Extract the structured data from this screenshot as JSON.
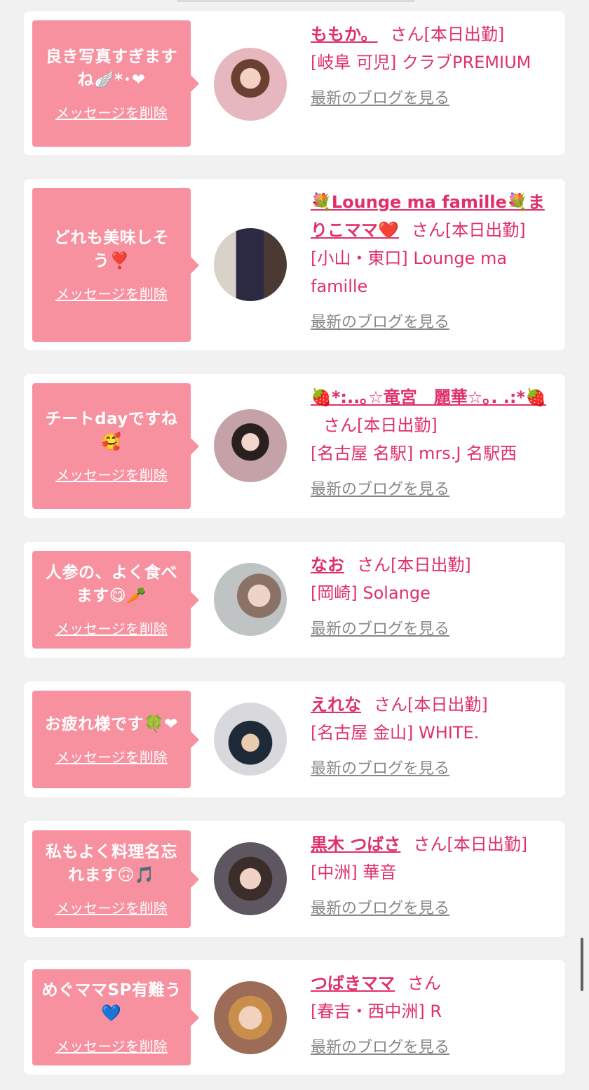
{
  "cards": [
    {
      "message": "良き写真すぎますね🪽*･❤︎",
      "delete_label": "メッセージを削除",
      "name": "ももか。",
      "san": "さん",
      "status": "[本日出勤]",
      "shop": "[岐阜 可児] クラブPREMIUM",
      "blog_label": "最新のブログを見る"
    },
    {
      "message": "どれも美味しそう❣️",
      "delete_label": "メッセージを削除",
      "name": "💐Lounge ma famille💐まりこママ❤️",
      "san": "さん",
      "status": "[本日出勤]",
      "shop": "[小山・東口] Lounge ma famille",
      "blog_label": "最新のブログを見る"
    },
    {
      "message": "チートdayですね🥰",
      "delete_label": "メッセージを削除",
      "name": "🍓*:..｡☆竜宮　麗華☆｡. .:*🍓",
      "san": "さん",
      "status": "[本日出勤]",
      "shop": "[名古屋 名駅] mrs.J 名駅西",
      "blog_label": "最新のブログを見る"
    },
    {
      "message": "人参の、よく食べます😋🥕",
      "delete_label": "メッセージを削除",
      "name": "なお",
      "san": "さん",
      "status": "[本日出勤]",
      "shop": "[岡崎] Solange",
      "blog_label": "最新のブログを見る"
    },
    {
      "message": "お疲れ様です🍀❤",
      "delete_label": "メッセージを削除",
      "name": "えれな",
      "san": "さん",
      "status": "[本日出勤]",
      "shop": "[名古屋 金山] WHITE.",
      "blog_label": "最新のブログを見る"
    },
    {
      "message": "私もよく料理名忘れます🙃🎵",
      "delete_label": "メッセージを削除",
      "name": "黒木 つばさ",
      "san": "さん",
      "status": "[本日出勤]",
      "shop": "[中洲] 華音",
      "blog_label": "最新のブログを見る"
    },
    {
      "message": "めぐママSP有難う💙",
      "delete_label": "メッセージを削除",
      "name": "つばきママ",
      "san": "さん",
      "status": "",
      "shop": "[春吉・西中洲] R",
      "blog_label": "最新のブログを見る"
    }
  ]
}
